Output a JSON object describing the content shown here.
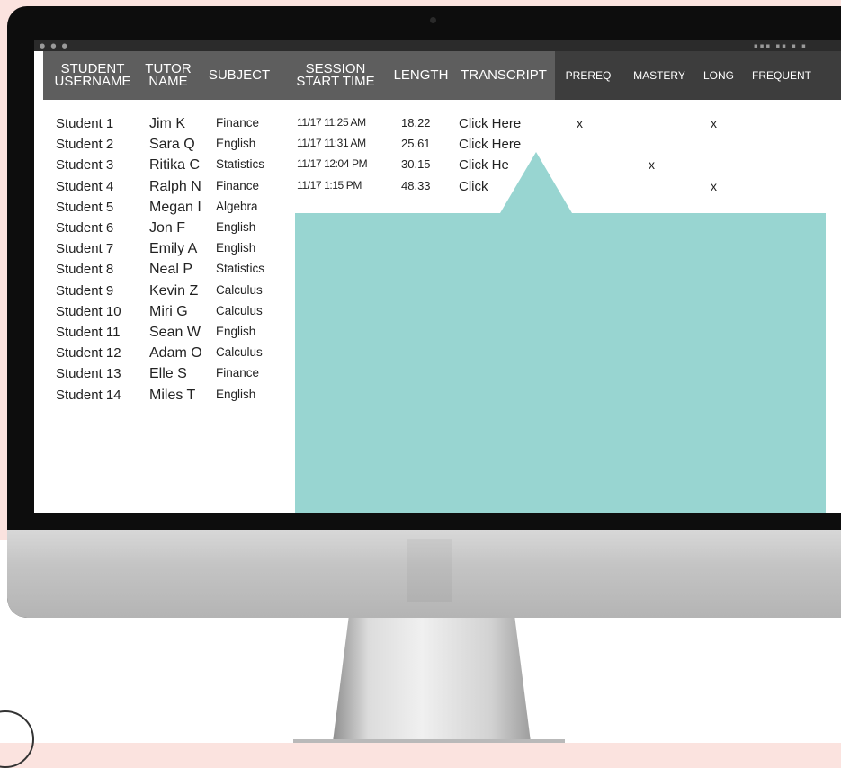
{
  "colors": {
    "page_background": "#fbe3df",
    "header_gray": "#5e5e5e",
    "header_dark": "#3d3d3d",
    "callout_teal": "#98d5d1"
  },
  "header": {
    "student_username": "STUDENT USERNAME",
    "tutor_name": "TUTOR NAME",
    "subject": "SUBJECT",
    "session_start_time": "SESSION START TIME",
    "length": "LENGTH",
    "transcript": "TRANSCRIPT",
    "prereq": "PREREQ",
    "mastery": "MASTERY",
    "long": "LONG",
    "frequent": "FREQUENT"
  },
  "rows": [
    {
      "student": "Student 1",
      "tutor": "Jim K",
      "subject": "Finance",
      "start": "11/17 11:25 AM",
      "length": "18.22",
      "transcript": "Click Here",
      "prereq": "x",
      "mastery": "",
      "long": "x"
    },
    {
      "student": "Student 2",
      "tutor": "Sara Q",
      "subject": "English",
      "start": "11/17 11:31 AM",
      "length": "25.61",
      "transcript": "Click Here",
      "prereq": "",
      "mastery": "",
      "long": ""
    },
    {
      "student": "Student 3",
      "tutor": "Ritika C",
      "subject": "Statistics",
      "start": "11/17 12:04 PM",
      "length": "30.15",
      "transcript": "Click He",
      "prereq": "",
      "mastery": "x",
      "long": ""
    },
    {
      "student": "Student 4",
      "tutor": "Ralph N",
      "subject": "Finance",
      "start": "11/17 1:15 PM",
      "length": "48.33",
      "transcript": "Click",
      "prereq": "",
      "mastery": "",
      "long": "x"
    },
    {
      "student": "Student 5",
      "tutor": "Megan I",
      "subject": "Algebra",
      "start": "",
      "length": "",
      "transcript": "",
      "prereq": "",
      "mastery": "",
      "long": ""
    },
    {
      "student": "Student 6",
      "tutor": "Jon F",
      "subject": "English",
      "start": "",
      "length": "",
      "transcript": "",
      "prereq": "",
      "mastery": "",
      "long": ""
    },
    {
      "student": "Student 7",
      "tutor": "Emily A",
      "subject": "English",
      "start": "",
      "length": "",
      "transcript": "",
      "prereq": "",
      "mastery": "",
      "long": ""
    },
    {
      "student": "Student 8",
      "tutor": "Neal P",
      "subject": "Statistics",
      "start": "",
      "length": "",
      "transcript": "",
      "prereq": "",
      "mastery": "",
      "long": ""
    },
    {
      "student": "Student 9",
      "tutor": "Kevin Z",
      "subject": "Calculus",
      "start": "",
      "length": "",
      "transcript": "",
      "prereq": "",
      "mastery": "",
      "long": ""
    },
    {
      "student": "Student 10",
      "tutor": "Miri G",
      "subject": "Calculus",
      "start": "",
      "length": "",
      "transcript": "",
      "prereq": "",
      "mastery": "",
      "long": ""
    },
    {
      "student": "Student 11",
      "tutor": "Sean W",
      "subject": "English",
      "start": "",
      "length": "",
      "transcript": "",
      "prereq": "",
      "mastery": "",
      "long": ""
    },
    {
      "student": "Student 12",
      "tutor": "Adam O",
      "subject": "Calculus",
      "start": "",
      "length": "",
      "transcript": "",
      "prereq": "",
      "mastery": "",
      "long": ""
    },
    {
      "student": "Student 13",
      "tutor": "Elle S",
      "subject": "Finance",
      "start": "",
      "length": "",
      "transcript": "",
      "prereq": "",
      "mastery": "",
      "long": ""
    },
    {
      "student": "Student 14",
      "tutor": "Miles T",
      "subject": "English",
      "start": "",
      "length": "",
      "transcript": "",
      "prereq": "",
      "mastery": "",
      "long": ""
    }
  ]
}
